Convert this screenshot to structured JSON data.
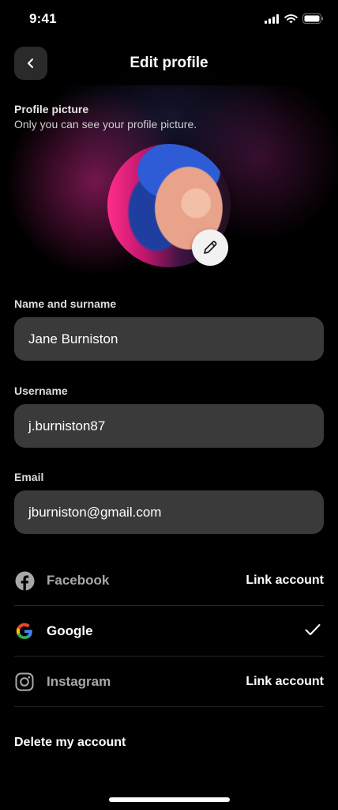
{
  "status_bar": {
    "time": "9:41"
  },
  "header": {
    "title": "Edit profile"
  },
  "profile_picture": {
    "title": "Profile picture",
    "subtitle": "Only you can see your profile picture."
  },
  "fields": {
    "name": {
      "label": "Name and surname",
      "value": "Jane Burniston"
    },
    "username": {
      "label": "Username",
      "value": "j.burniston87"
    },
    "email": {
      "label": "Email",
      "value": "jburniston@gmail.com"
    }
  },
  "linked_accounts": [
    {
      "name": "Facebook",
      "icon": "facebook-icon",
      "linked": false,
      "action": "Link account"
    },
    {
      "name": "Google",
      "icon": "google-icon",
      "linked": true,
      "action": ""
    },
    {
      "name": "Instagram",
      "icon": "instagram-icon",
      "linked": false,
      "action": "Link account"
    }
  ],
  "delete_account": {
    "label": "Delete my account"
  },
  "colors": {
    "background": "#000000",
    "field_background": "#3a3a3a",
    "muted_text": "#a8a8a8",
    "accent_pink": "#ff2d8a"
  }
}
